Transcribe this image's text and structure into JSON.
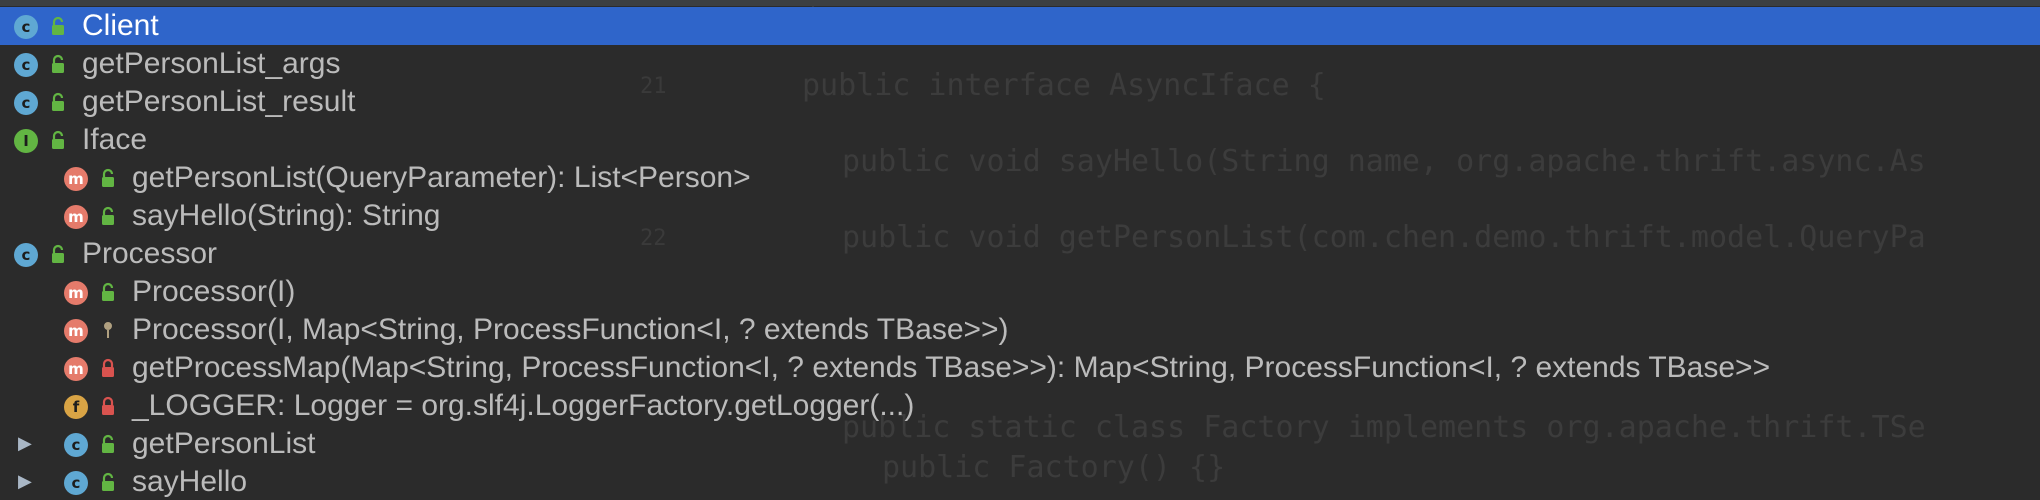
{
  "editor_background": {
    "code_lines": [
      "public interface AsyncIface {",
      "public void sayHello(String name, org.apache.thrift.async.As",
      "public void getPersonList(com.chen.demo.thrift.model.QueryPa",
      "public static class Factory implements org.apache.thrift.TSe",
      "public Factory() {}"
    ],
    "line_numbers": [
      "21",
      "22"
    ]
  },
  "structure_popup": {
    "selected_index": 0,
    "items": [
      {
        "label": "Client",
        "kind": "C",
        "visibility": "public",
        "indent": 0,
        "expandable": false
      },
      {
        "label": "getPersonList_args",
        "kind": "C",
        "visibility": "public",
        "indent": 0,
        "expandable": false
      },
      {
        "label": "getPersonList_result",
        "kind": "C",
        "visibility": "public",
        "indent": 0,
        "expandable": false
      },
      {
        "label": "Iface",
        "kind": "I",
        "visibility": "public",
        "indent": 0,
        "expandable": false
      },
      {
        "label": "getPersonList(QueryParameter): List<Person>",
        "kind": "m",
        "visibility": "public",
        "indent": 1,
        "expandable": false
      },
      {
        "label": "sayHello(String): String",
        "kind": "m",
        "visibility": "public",
        "indent": 1,
        "expandable": false
      },
      {
        "label": "Processor",
        "kind": "C",
        "visibility": "public",
        "indent": 0,
        "expandable": false
      },
      {
        "label": "Processor(I)",
        "kind": "m",
        "visibility": "public",
        "indent": 1,
        "expandable": false
      },
      {
        "label": "Processor(I, Map<String, ProcessFunction<I, ? extends TBase>>)",
        "kind": "m",
        "visibility": "protected",
        "indent": 1,
        "expandable": false
      },
      {
        "label": "getProcessMap(Map<String, ProcessFunction<I, ? extends TBase>>): Map<String, ProcessFunction<I, ? extends TBase>>",
        "kind": "m",
        "visibility": "private",
        "indent": 1,
        "expandable": false
      },
      {
        "label": "_LOGGER: Logger = org.slf4j.LoggerFactory.getLogger(...)",
        "kind": "f",
        "visibility": "private",
        "indent": 1,
        "expandable": false
      },
      {
        "label": "getPersonList",
        "kind": "C",
        "visibility": "public",
        "indent": 1,
        "expandable": true
      },
      {
        "label": "sayHello",
        "kind": "C",
        "visibility": "public",
        "indent": 1,
        "expandable": true
      }
    ]
  },
  "colors": {
    "selection": "#2f65ca",
    "text": "#bbbbbb",
    "class_icon": "#5fa8d3",
    "interface_icon": "#62b543",
    "method_icon": "#e57b6b",
    "field_icon": "#d9a445",
    "public_lock": "#62b543",
    "private_lock": "#d9534f"
  }
}
